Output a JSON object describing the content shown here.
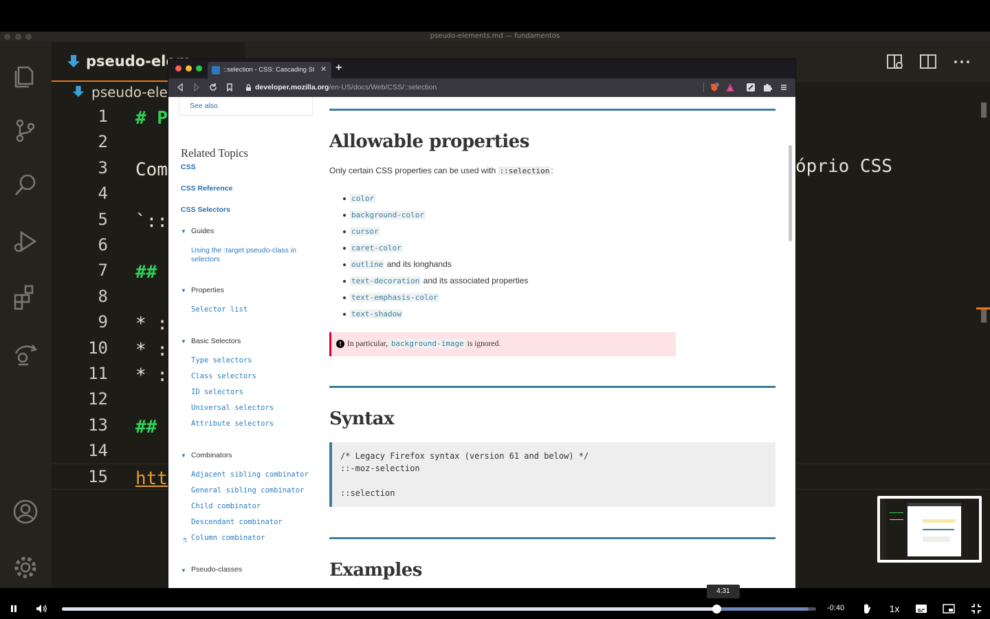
{
  "vscode": {
    "window_title": "pseudo-elements.md — fundamentos",
    "tab_label": "pseudo-elem",
    "breadcrumb_label": "pseudo-elem",
    "line_numbers": [
      "1",
      "2",
      "3",
      "4",
      "5",
      "6",
      "7",
      "8",
      "9",
      "10",
      "11",
      "12",
      "13",
      "14",
      "15"
    ],
    "code_lines": [
      "# P",
      "",
      "Com",
      "",
      "`::",
      "",
      "## ",
      "",
      "* :",
      "* :",
      "* :",
      "",
      "## ",
      "",
      "htt"
    ],
    "code_right_text": "óprio CSS",
    "activity_icons": [
      "files-icon",
      "source-control-icon",
      "search-icon",
      "run-debug-icon",
      "extensions-icon",
      "remote-icon",
      "account-icon",
      "settings-gear-icon"
    ]
  },
  "browser": {
    "tab_title": "::selection - CSS: Cascading Sty",
    "url_domain": "developer.mozilla.org",
    "url_path": "/en-US/docs/Web/CSS/::selection",
    "sidebar": {
      "see_also": "See also",
      "related_title": "Related Topics",
      "links": [
        "CSS",
        "CSS Reference",
        "CSS Selectors"
      ],
      "guides_label": "Guides",
      "guides_item": "Using the :target pseudo-class in selectors",
      "properties_label": "Properties",
      "properties_item": "Selector list",
      "basic_selectors_label": "Basic Selectors",
      "basic_selectors": [
        "Type selectors",
        "Class selectors",
        "ID selectors",
        "Universal selectors",
        "Attribute selectors"
      ],
      "combinators_label": "Combinators",
      "combinators": [
        "Adjacent sibling combinator",
        "General sibling combinator",
        "Child combinator",
        "Descendant combinator",
        "Column combinator"
      ],
      "pseudo_classes_label": "Pseudo-classes"
    },
    "article": {
      "allowable_heading": "Allowable properties",
      "intro_text": "Only certain CSS properties can be used with ",
      "intro_code": "::selection",
      "intro_end": ":",
      "properties": [
        {
          "code": "color",
          "suffix": ""
        },
        {
          "code": "background-color",
          "suffix": ""
        },
        {
          "code": "cursor",
          "suffix": ""
        },
        {
          "code": "caret-color",
          "suffix": ""
        },
        {
          "code": "outline",
          "suffix": " and its longhands"
        },
        {
          "code": "text-decoration",
          "suffix": " and its associated properties"
        },
        {
          "code": "text-emphasis-color",
          "suffix": ""
        },
        {
          "code": "text-shadow",
          "suffix": ""
        }
      ],
      "note_prefix": "In particular, ",
      "note_code": "background-image",
      "note_suffix": " is ignored.",
      "syntax_heading": "Syntax",
      "syntax_lines": [
        "/* Legacy Firefox syntax (version 61 and below) */",
        "::-moz-selection",
        "",
        "::selection"
      ],
      "examples_heading": "Examples"
    }
  },
  "player": {
    "tooltip_time": "4:31",
    "time_remaining": "-0:40",
    "progress_fraction": 0.868,
    "buffer_fraction": 0.99,
    "speed_label": "1x"
  }
}
